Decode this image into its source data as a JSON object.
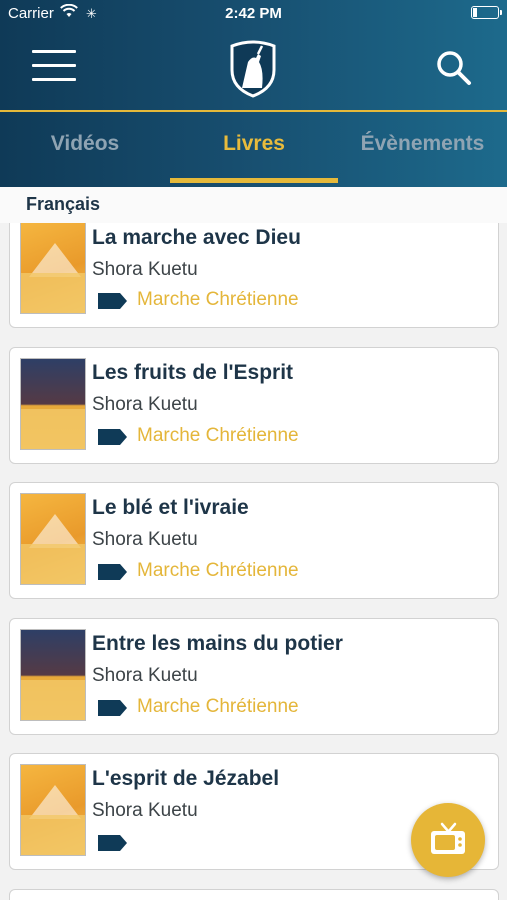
{
  "status_bar": {
    "carrier": "Carrier",
    "time": "2:42 PM"
  },
  "header": {
    "menu_icon": "hamburger-menu-icon",
    "logo_icon": "shield-logo-icon",
    "search_icon": "search-icon"
  },
  "tabs": [
    {
      "label": "Vidéos",
      "selected": false
    },
    {
      "label": "Livres",
      "selected": true
    },
    {
      "label": "Évènements",
      "selected": false
    }
  ],
  "section": {
    "language": "Français"
  },
  "books": [
    {
      "title": "La marche avec Dieu",
      "author": "Shora Kuetu",
      "category": "Marche Chrétienne"
    },
    {
      "title": "Les fruits de l'Esprit",
      "author": "Shora Kuetu",
      "category": "Marche Chrétienne"
    },
    {
      "title": "Le blé et l'ivraie",
      "author": "Shora Kuetu",
      "category": "Marche Chrétienne"
    },
    {
      "title": "Entre les mains du potier",
      "author": "Shora Kuetu",
      "category": "Marche Chrétienne"
    },
    {
      "title": "L'esprit de Jézabel",
      "author": "Shora Kuetu",
      "category": ""
    }
  ],
  "fab": {
    "icon": "tv-icon"
  },
  "colors": {
    "header": "#174d6e",
    "accent": "#e5b93a",
    "title": "#1e3548",
    "tag": "#0f3a57"
  }
}
